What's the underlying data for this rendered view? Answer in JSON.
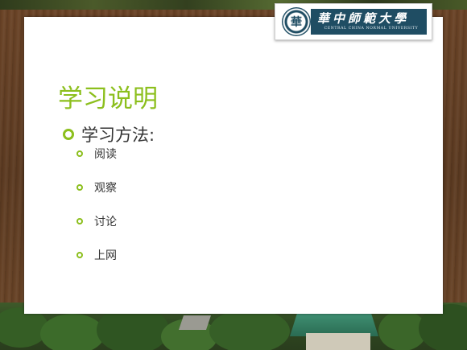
{
  "logo": {
    "seal_char": "華",
    "name_cn": "華中師範大學",
    "name_en": "CENTRAL CHINA NORMAL UNIVERSITY"
  },
  "slide": {
    "title": "学习说明",
    "main_bullet": "学习方法:",
    "sub_bullets": [
      "阅读",
      "观察",
      "讨论",
      "上网"
    ]
  },
  "colors": {
    "accent": "#8cbf1d",
    "logo_band": "#1f4d63",
    "text": "#333333"
  }
}
